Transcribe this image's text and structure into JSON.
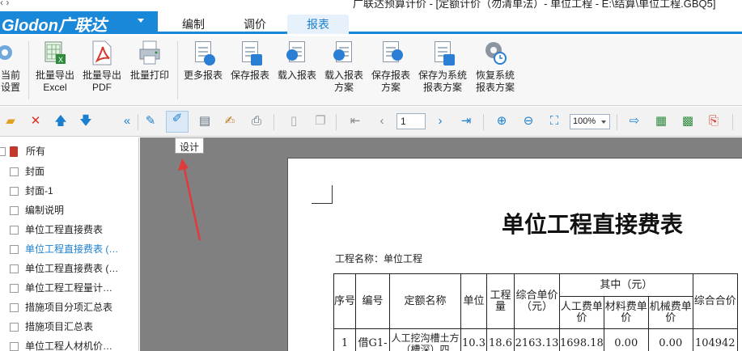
{
  "window": {
    "nav_glyph": "‹ ›",
    "title": "广联达预算计价 - [定额计价（勿清单法）- 单位工程 - E:\\结算\\单位工程.GBQ5]"
  },
  "brand": {
    "name": "Glodon广联达",
    "color": "#1a88d8"
  },
  "tabs": [
    {
      "label": "编制"
    },
    {
      "label": "调价"
    },
    {
      "label": "报表",
      "active": true
    }
  ],
  "ribbon": {
    "buttons": [
      {
        "l1": "当前",
        "l2": "设置"
      },
      {
        "l1": "批量导出",
        "l2": "Excel"
      },
      {
        "l1": "批量导出",
        "l2": "PDF"
      },
      {
        "l1": "批量打印",
        "l2": ""
      },
      {
        "l1": "更多报表",
        "l2": ""
      },
      {
        "l1": "保存报表",
        "l2": ""
      },
      {
        "l1": "载入报表",
        "l2": ""
      },
      {
        "l1": "载入报表",
        "l2": "方案"
      },
      {
        "l1": "保存报表",
        "l2": "方案"
      },
      {
        "l1": "保存为系统",
        "l2": "报表方案"
      },
      {
        "l1": "恢复系统",
        "l2": "报表方案"
      }
    ]
  },
  "toolbar": {
    "page": "1",
    "zoom": "100%",
    "tooltip": "设计",
    "collapse_glyph": "«"
  },
  "tree": {
    "items": [
      {
        "label": "所有",
        "root": true
      },
      {
        "label": "封面"
      },
      {
        "label": "封面-1"
      },
      {
        "label": "编制说明"
      },
      {
        "label": "单位工程直接费表"
      },
      {
        "label": "单位工程直接费表 (…",
        "selected": true
      },
      {
        "label": "单位工程直接费表 (…"
      },
      {
        "label": "单位工程工程量计…"
      },
      {
        "label": "措施项目分项汇总表"
      },
      {
        "label": "措施项目汇总表"
      },
      {
        "label": "单位工程人材机价…"
      }
    ]
  },
  "report": {
    "title": "单位工程直接费表",
    "project_label": "工程名称：单位工程",
    "headers": {
      "seq": "序号",
      "code": "编号",
      "name": "定额名称",
      "unit": "单位",
      "qty": "工程量",
      "unit_price": "综合单价（元）",
      "among": "其中（元）",
      "labor": "人工费单价",
      "material": "材料费单价",
      "machine": "机械费单价",
      "total": "综合合价"
    },
    "row1": {
      "seq": "1",
      "code": "借G1-",
      "name": "人工挖沟槽土方（槽深）四",
      "unit": "10.3",
      "qty": "18.6",
      "unit_price": "2163.13",
      "labor": "1698.18",
      "material": "0.00",
      "machine": "0.00",
      "total": "104942"
    }
  },
  "accent_red": "#e03a3a"
}
